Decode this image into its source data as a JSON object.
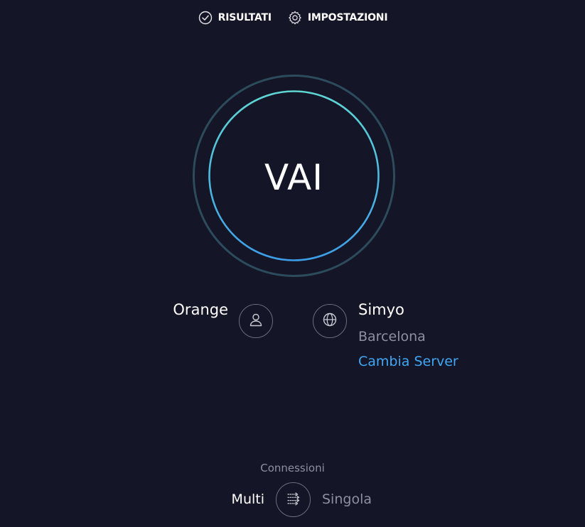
{
  "nav": {
    "results": {
      "label": "RISULTATI",
      "icon": "check-circle-icon"
    },
    "settings": {
      "label": "IMPOSTAZIONI",
      "icon": "gear-icon"
    }
  },
  "go_button": {
    "label": "VAI"
  },
  "isp": {
    "name": "Orange",
    "icon": "user-icon"
  },
  "server": {
    "name": "Simyo",
    "location": "Barcelona",
    "change_label": "Cambia Server",
    "icon": "globe-icon"
  },
  "connections": {
    "title": "Connessioni",
    "multi_label": "Multi",
    "single_label": "Singola",
    "selected": "Multi",
    "icon": "connections-toggle-icon"
  },
  "colors": {
    "background": "#141526",
    "accent_blue": "#40a7f5",
    "ring_cyan": "#5fd6d4",
    "muted_text": "#8d8fa3"
  }
}
